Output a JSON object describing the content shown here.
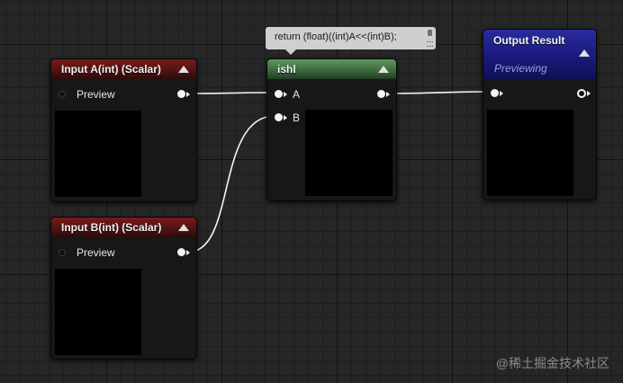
{
  "graph": {
    "node_input_a": {
      "title": "Input A(int) (Scalar)",
      "pin_label": "Preview"
    },
    "node_input_b": {
      "title": "Input B(int) (Scalar)",
      "pin_label": "Preview"
    },
    "node_ishl": {
      "title": "ishl",
      "pin_a_label": "A",
      "pin_b_label": "B",
      "code_comment": "return (float)((int)A<<(int)B);"
    },
    "node_output": {
      "title": "Output Result",
      "subtitle": "Previewing"
    }
  },
  "colors": {
    "input_header": "#7a1a1a",
    "custom_header": "#4f854f",
    "output_header": "#2323a0",
    "wire": "#f4f4f4"
  },
  "watermark": "@稀土掘金技术社区"
}
